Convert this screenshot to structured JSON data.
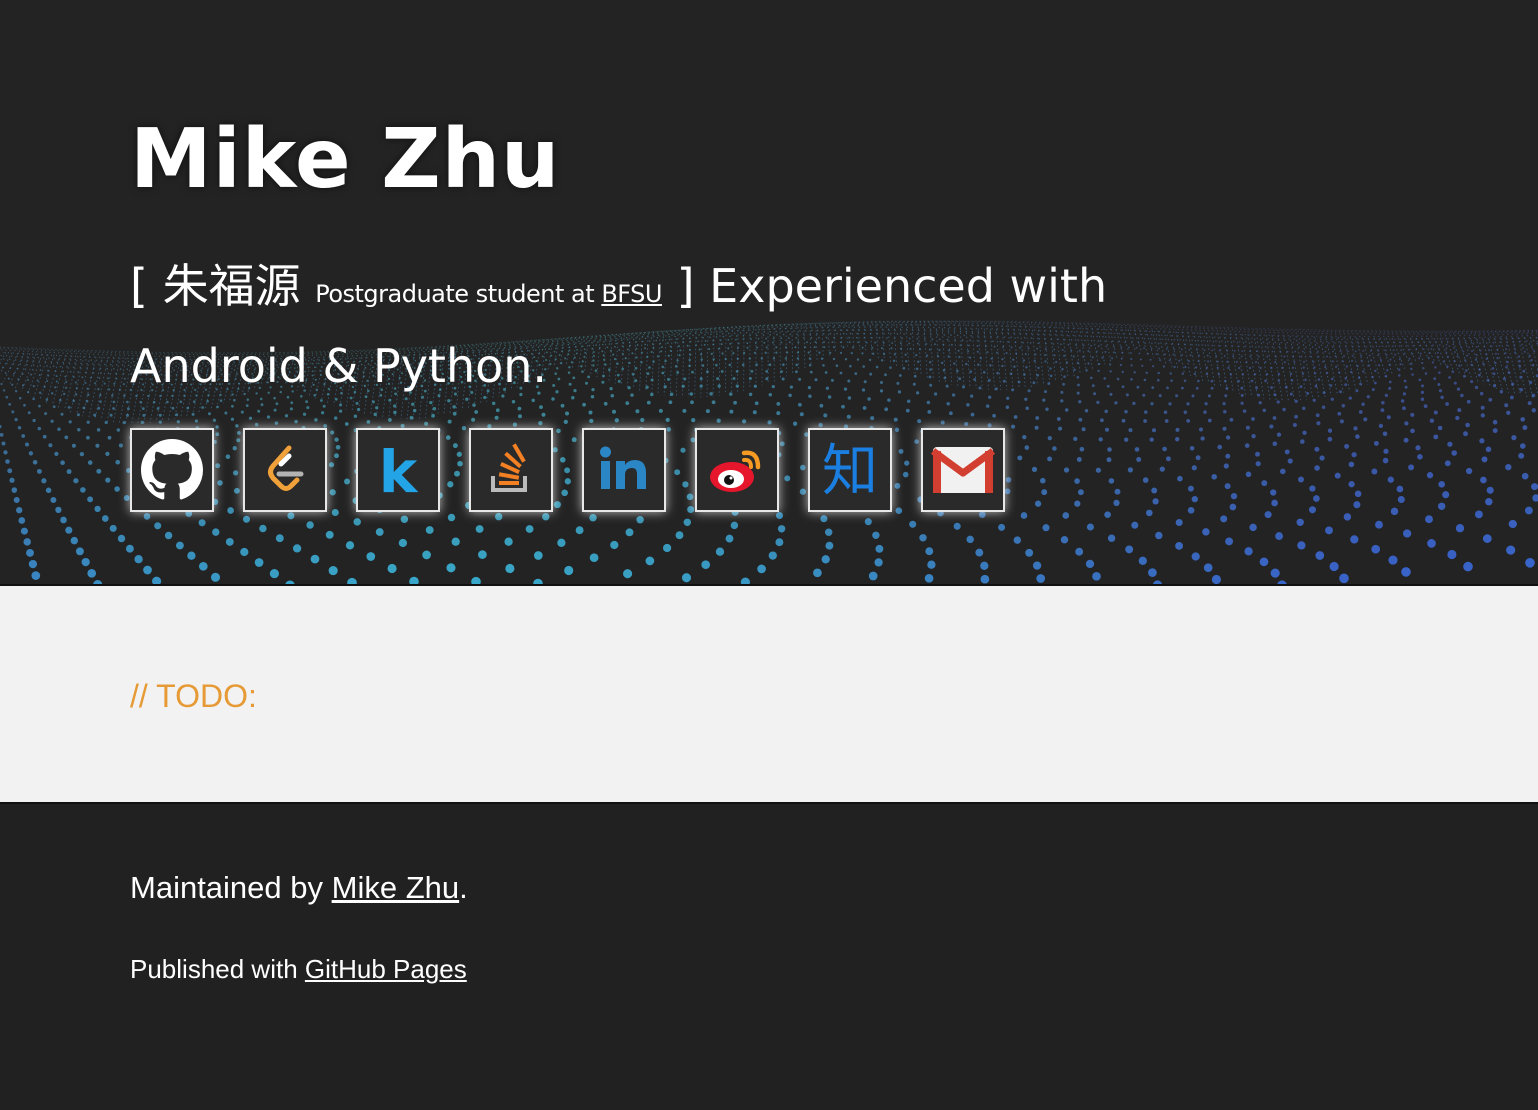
{
  "header": {
    "title": "Mike Zhu",
    "tagline_open": "[ ",
    "chinese_name": "朱福源",
    "role_prefix": "Postgraduate student at ",
    "school_link": "BFSU",
    "tagline_close": " ]",
    "tagline_main": "Experienced with Android & Python."
  },
  "socials": [
    {
      "name": "github",
      "icon": "github-icon"
    },
    {
      "name": "leetcode",
      "icon": "leetcode-icon"
    },
    {
      "name": "kaggle",
      "icon": "kaggle-icon"
    },
    {
      "name": "stackoverflow",
      "icon": "stackoverflow-icon"
    },
    {
      "name": "linkedin",
      "icon": "linkedin-icon"
    },
    {
      "name": "weibo",
      "icon": "weibo-icon"
    },
    {
      "name": "zhihu",
      "icon": "zhihu-icon",
      "glyph": "知"
    },
    {
      "name": "gmail",
      "icon": "gmail-icon"
    }
  ],
  "main": {
    "todo": "// TODO:"
  },
  "footer": {
    "maintained_prefix": "Maintained by ",
    "maintained_link": "Mike Zhu",
    "maintained_suffix": ".",
    "published_prefix": "Published with ",
    "published_link": "GitHub Pages"
  },
  "colors": {
    "header_bg": "#232323",
    "main_bg": "#f2f2f2",
    "footer_bg": "#212121",
    "todo": "#e69a36",
    "dots": "#5aa0d8"
  }
}
